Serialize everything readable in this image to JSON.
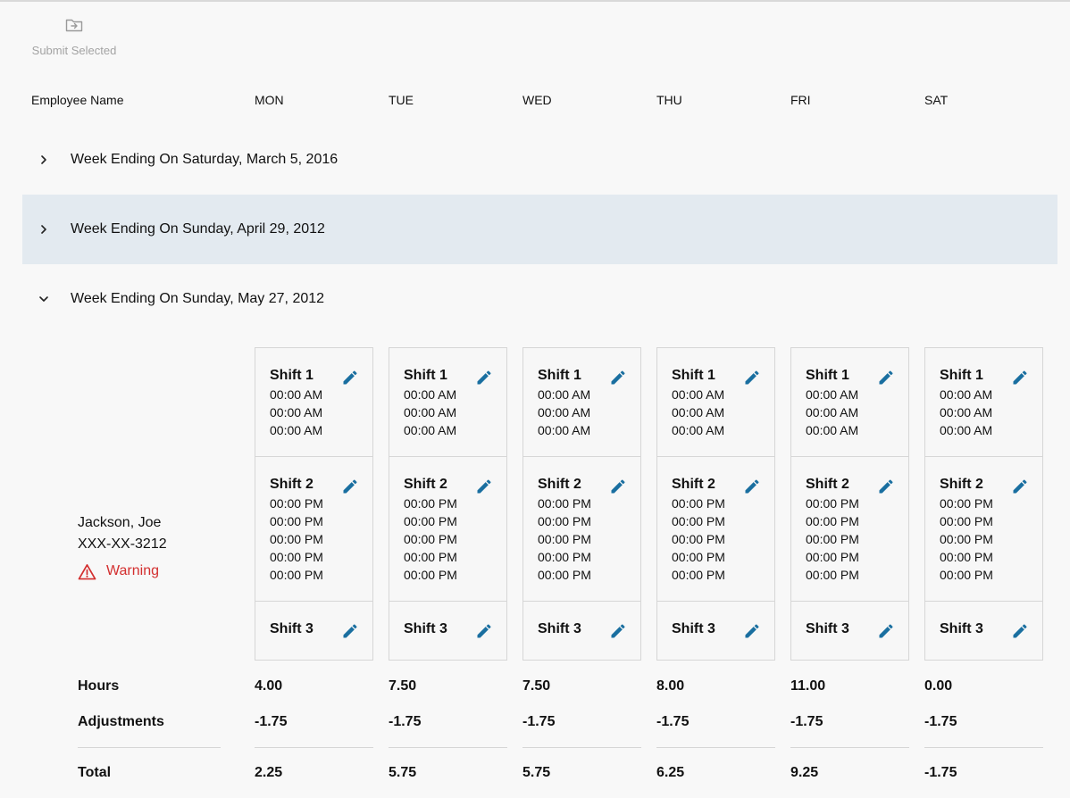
{
  "toolbar": {
    "submit_label": "Submit Selected",
    "submit_icon": "folder-arrow-icon"
  },
  "columns": {
    "employee": "Employee Name",
    "days": [
      "MON",
      "TUE",
      "WED",
      "THU",
      "FRI",
      "SAT"
    ]
  },
  "weeks": [
    {
      "title": "Week Ending On Saturday, March 5, 2016",
      "expanded": false
    },
    {
      "title": "Week Ending On Sunday, April 29, 2012",
      "expanded": false,
      "highlighted": true
    },
    {
      "title": "Week Ending On Sunday, May 27, 2012",
      "expanded": true
    }
  ],
  "employee": {
    "name": "Jackson, Joe",
    "ssn": "XXX-XX-3212",
    "warning": "Warning"
  },
  "shifts": {
    "shift1": {
      "label": "Shift 1",
      "times": [
        "00:00 AM",
        "00:00 AM",
        "00:00 AM"
      ]
    },
    "shift2": {
      "label": "Shift 2",
      "times": [
        "00:00 PM",
        "00:00 PM",
        "00:00 PM",
        "00:00 PM",
        "00:00 PM"
      ]
    },
    "shift3": {
      "label": "Shift 3",
      "times": []
    }
  },
  "summary": {
    "hours_label": "Hours",
    "adjustments_label": "Adjustments",
    "total_label": "Total",
    "hours": [
      "4.00",
      "7.50",
      "7.50",
      "8.00",
      "11.00",
      "0.00"
    ],
    "adjustments": [
      "-1.75",
      "-1.75",
      "-1.75",
      "-1.75",
      "-1.75",
      "-1.75"
    ],
    "totals": [
      "2.25",
      "5.75",
      "5.75",
      "6.25",
      "9.25",
      "-1.75"
    ]
  },
  "colors": {
    "accent": "#1a6fa0",
    "warning": "#d32f2f",
    "highlight_row": "#e3eaf0"
  }
}
